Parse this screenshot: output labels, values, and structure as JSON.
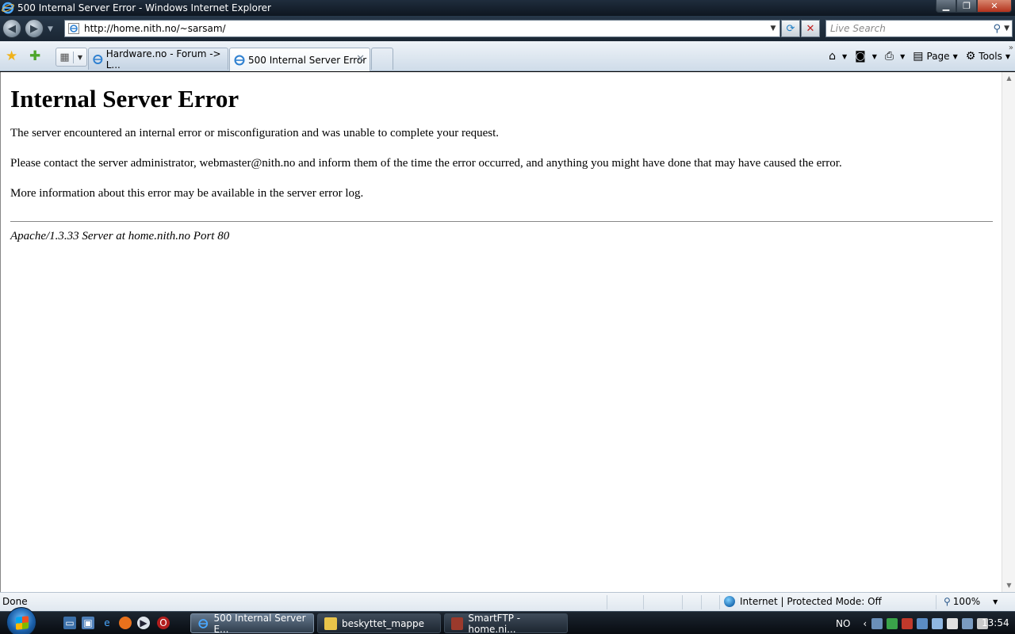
{
  "window": {
    "title": "500 Internal Server Error - Windows Internet Explorer",
    "controls": {
      "minimize": "▁",
      "maximize": "❐",
      "close": "✕"
    }
  },
  "nav": {
    "url": "http://home.nith.no/~sarsam/",
    "search_placeholder": "Live Search"
  },
  "tabs": [
    {
      "label": "Hardware.no - Forum -> L...",
      "active": false
    },
    {
      "label": "500 Internal Server Error",
      "active": true
    }
  ],
  "commandbar": {
    "page_label": "Page",
    "tools_label": "Tools"
  },
  "page": {
    "heading": "Internal Server Error",
    "paragraph1": "The server encountered an internal error or misconfiguration and was unable to complete your request.",
    "paragraph2": "Please contact the server administrator, webmaster@nith.no and inform them of the time the error occurred, and anything you might have done that may have caused the error.",
    "paragraph3": "More information about this error may be available in the server error log.",
    "footer": "Apache/1.3.33 Server at home.nith.no Port 80"
  },
  "statusbar": {
    "status": "Done",
    "zone": "Internet | Protected Mode: Off",
    "zoom": "100%"
  },
  "taskbar": {
    "buttons": [
      {
        "label": "500 Internal Server E...",
        "active": true
      },
      {
        "label": "beskyttet_mappe",
        "active": false
      },
      {
        "label": "SmartFTP - home.ni...",
        "active": false
      }
    ],
    "language": "NO",
    "clock": "13:54"
  },
  "colors": {
    "titlebar": "#1f2d3d",
    "taskbar": "#0e141b",
    "content_bg": "#ffffff",
    "close_button": "#c0392b"
  }
}
